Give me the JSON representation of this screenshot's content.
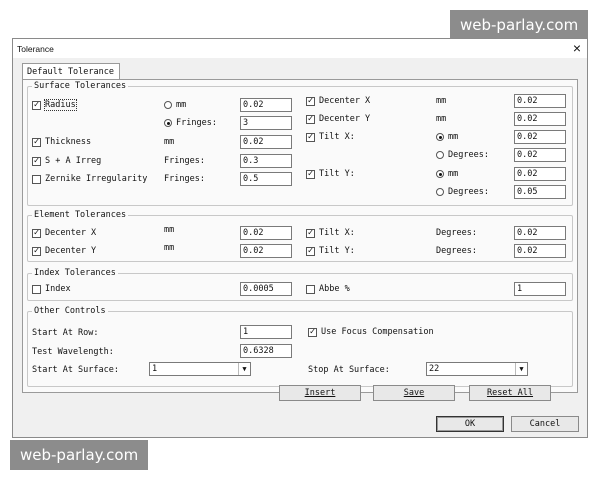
{
  "watermark": {
    "text": "web-parlay.com"
  },
  "window": {
    "title": "Tolerance",
    "close_glyph": "×"
  },
  "tab": {
    "label": "Default Tolerance"
  },
  "surface": {
    "group_label": "Surface Tolerances",
    "radius": {
      "label": "Radius",
      "checked": true,
      "opt_mm": "mm",
      "opt_fringes": "Fringes:",
      "selected": "Fringes:",
      "val_mm": "0.02",
      "val_fringes": "3"
    },
    "thickness": {
      "label": "Thickness",
      "checked": true,
      "unit": "mm",
      "value": "0.02"
    },
    "sa_irreg": {
      "label": "S + A Irreg",
      "checked": true,
      "unit": "Fringes:",
      "value": "0.3"
    },
    "zernike": {
      "label": "Zernike Irregularity",
      "checked": false,
      "unit": "Fringes:",
      "value": "0.5"
    },
    "decenter_x": {
      "label": "Decenter X",
      "checked": true,
      "unit": "mm",
      "value": "0.02"
    },
    "decenter_y": {
      "label": "Decenter Y",
      "checked": true,
      "unit": "mm",
      "value": "0.02"
    },
    "tilt_x": {
      "label": "Tilt X:",
      "checked": true,
      "opt_mm": "mm",
      "opt_deg": "Degrees:",
      "selected": "mm",
      "val_mm": "0.02",
      "val_deg": "0.02"
    },
    "tilt_y": {
      "label": "Tilt Y:",
      "checked": true,
      "opt_mm": "mm",
      "opt_deg": "Degrees:",
      "selected": "mm",
      "val_mm": "0.02",
      "val_deg": "0.05"
    }
  },
  "element": {
    "group_label": "Element Tolerances",
    "decenter_x": {
      "label": "Decenter X",
      "checked": true,
      "unit": "mm",
      "value": "0.02"
    },
    "decenter_y": {
      "label": "Decenter Y",
      "checked": true,
      "unit": "mm",
      "value": "0.02"
    },
    "tilt_x": {
      "label": "Tilt X:",
      "checked": true,
      "unit": "Degrees:",
      "value": "0.02"
    },
    "tilt_y": {
      "label": "Tilt Y:",
      "checked": true,
      "unit": "Degrees:",
      "value": "0.02"
    }
  },
  "index": {
    "group_label": "Index Tolerances",
    "index": {
      "label": "Index",
      "checked": false,
      "value": "0.0005"
    },
    "abbe": {
      "label": "Abbe %",
      "checked": false,
      "value": "1"
    }
  },
  "other": {
    "group_label": "Other Controls",
    "start_row": {
      "label": "Start At Row:",
      "value": "1"
    },
    "test_wavelength": {
      "label": "Test Wavelength:",
      "value": "0.6328"
    },
    "start_surface": {
      "label": "Start At Surface:",
      "value": "1"
    },
    "focus_comp": {
      "label": "Use Focus Compensation",
      "checked": true
    },
    "stop_surface": {
      "label": "Stop At Surface:",
      "value": "22"
    }
  },
  "buttons": {
    "insert": "Insert",
    "save": "Save",
    "reset_all": "Reset All",
    "ok": "OK",
    "cancel": "Cancel"
  },
  "glyphs": {
    "check": "✓",
    "dropdown": "▼"
  }
}
